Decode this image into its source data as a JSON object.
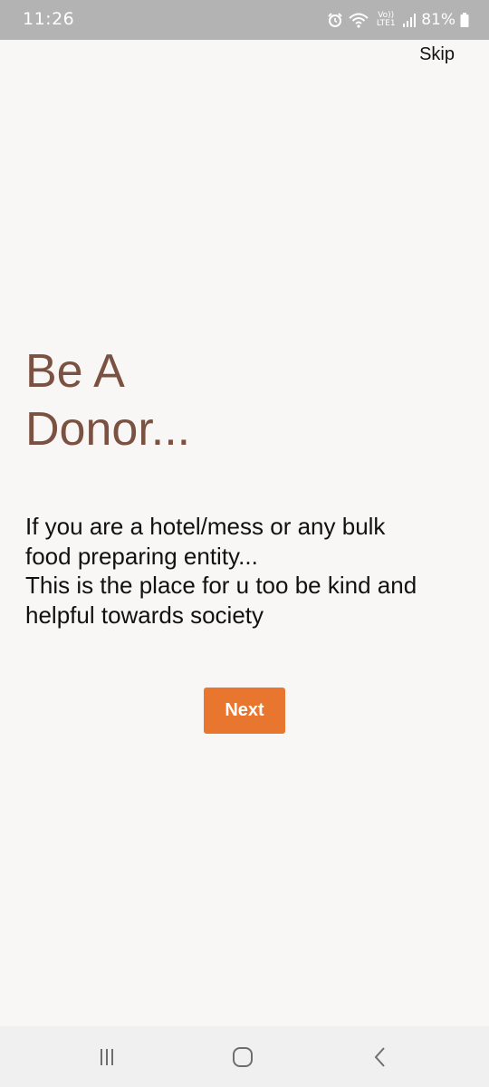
{
  "status_bar": {
    "time": "11:26",
    "battery_percent": "81%",
    "network_label": "Vo)) LTE1",
    "icons": [
      "alarm-icon",
      "wifi-icon",
      "signal-icon",
      "battery-icon"
    ],
    "background_color": "#b3b3b3"
  },
  "header": {
    "skip_label": "Skip"
  },
  "onboarding": {
    "title_lines": [
      "Be A",
      "Donor..."
    ],
    "description_lines": [
      "If you are a hotel/mess or any bulk",
      "food preparing entity...",
      "This is the place for u too be kind and",
      "helpful towards society"
    ],
    "next_label": "Next"
  },
  "colors": {
    "title": "#7b5141",
    "accent": "#e8762e",
    "background": "#f8f7f6"
  },
  "nav_bar": {
    "buttons": [
      "recent-apps-icon",
      "home-icon",
      "back-icon"
    ]
  }
}
